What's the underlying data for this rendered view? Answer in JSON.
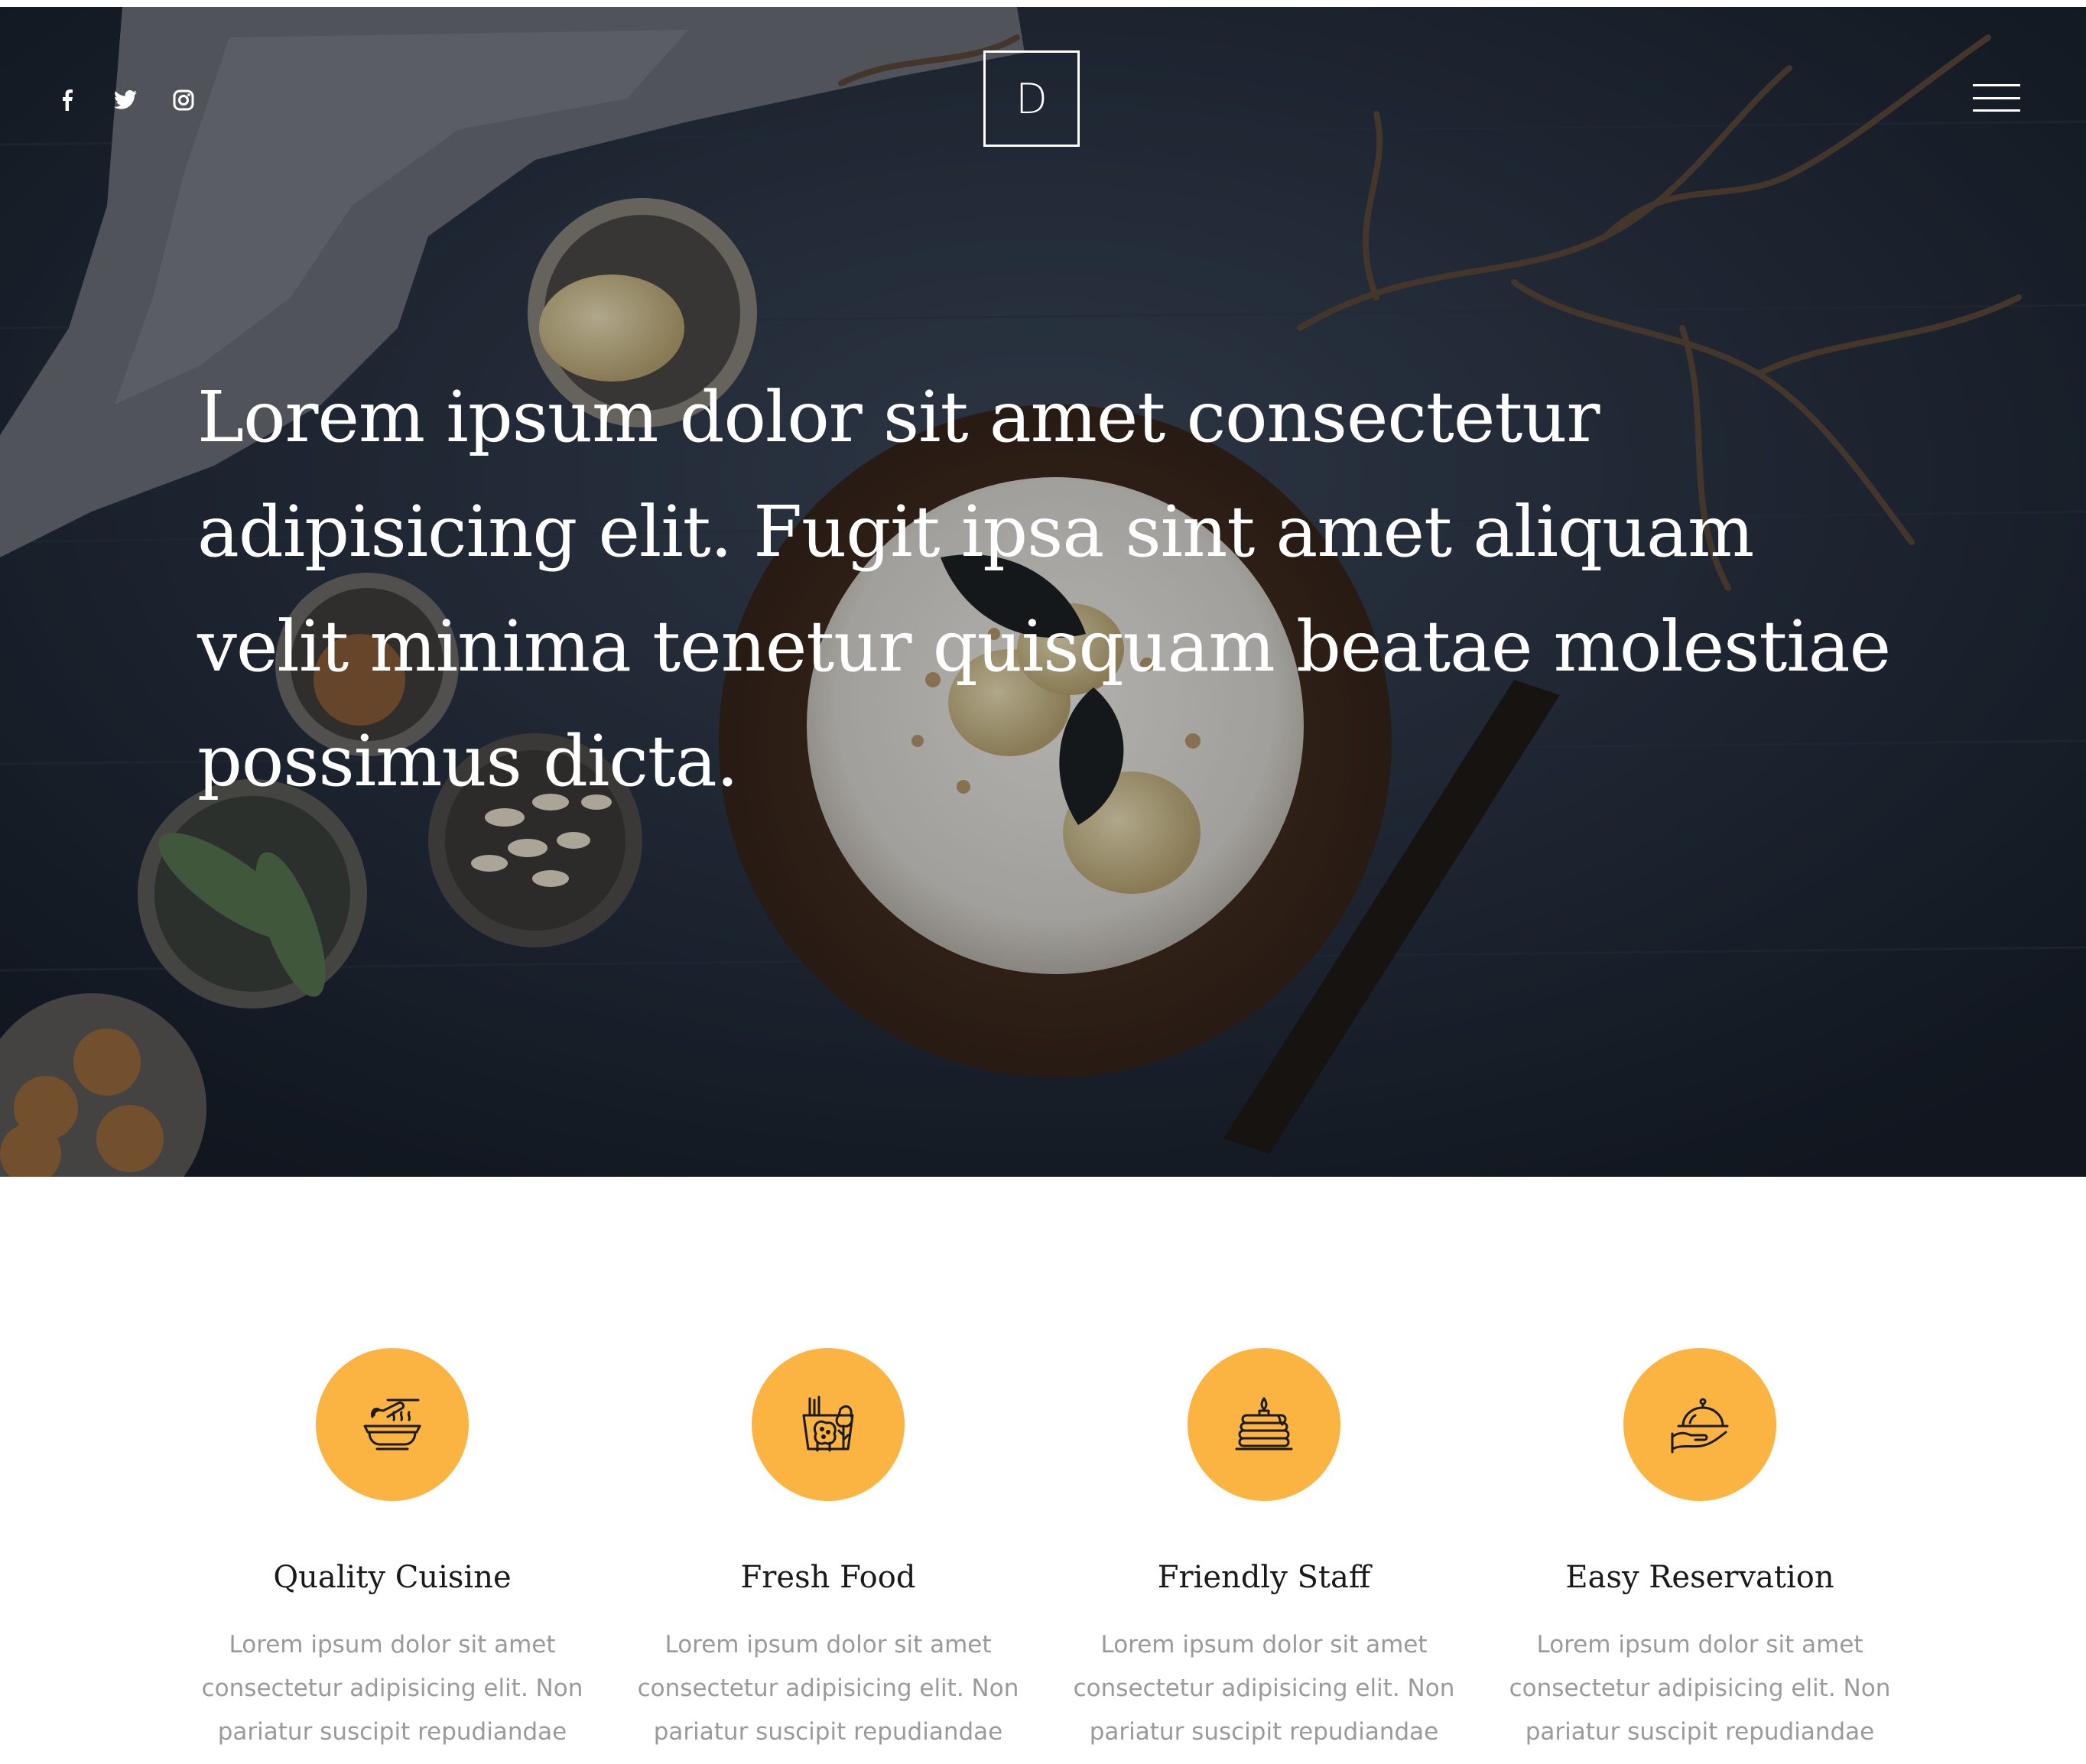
{
  "header": {
    "social": [
      {
        "icon": "facebook-icon",
        "label": "Facebook"
      },
      {
        "icon": "twitter-icon",
        "label": "Twitter"
      },
      {
        "icon": "instagram-icon",
        "label": "Instagram"
      }
    ],
    "logo_letter": "D",
    "menu_icon": "hamburger-menu-icon"
  },
  "hero": {
    "headline": "Lorem ipsum dolor sit amet consectetur adipisicing elit. Fugit ipsa sint amet aliquam velit minima tenetur quisquam beatae molestiae possimus dicta."
  },
  "features": [
    {
      "icon": "cooking-pot-icon",
      "title": "Quality Cuisine",
      "text": "Lorem ipsum dolor sit amet consectetur adipisicing elit. Non pariatur suscipit repudiandae facilis"
    },
    {
      "icon": "fresh-vegetables-icon",
      "title": "Fresh Food",
      "text": "Lorem ipsum dolor sit amet consectetur adipisicing elit. Non pariatur suscipit repudiandae facilis"
    },
    {
      "icon": "pancakes-icon",
      "title": "Friendly Staff",
      "text": "Lorem ipsum dolor sit amet consectetur adipisicing elit. Non pariatur suscipit repudiandae facilis"
    },
    {
      "icon": "serving-cloche-icon",
      "title": "Easy Reservation",
      "text": "Lorem ipsum dolor sit amet consectetur adipisicing elit. Non pariatur suscipit repudiandae facilis"
    }
  ],
  "colors": {
    "accent": "#fbb342",
    "hero_bg": "#1e2633",
    "heading_text": "#1a1a1a",
    "body_text": "#9a9a9a"
  }
}
